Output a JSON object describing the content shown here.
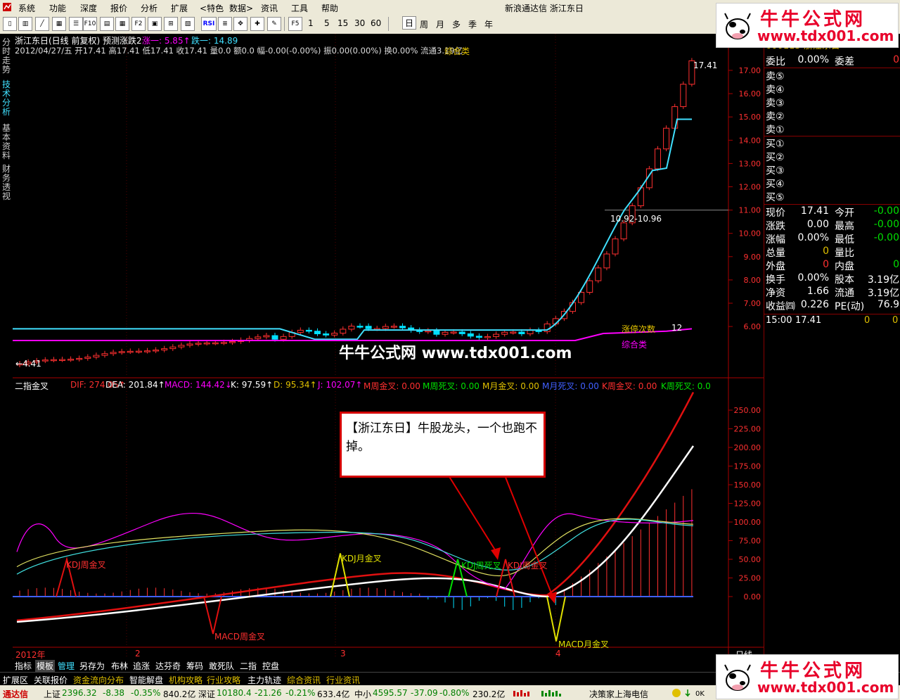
{
  "menubar": {
    "items": [
      "系统",
      "功能",
      "深度",
      "报价",
      "分析",
      "扩展",
      "特色",
      "数据",
      "资讯",
      "工具",
      "帮助"
    ],
    "title": "新浪通达信  浙江东日"
  },
  "toolbar": {
    "periods": [
      "1",
      "5",
      "15",
      "30",
      "60"
    ],
    "cycles": [
      "日",
      "周",
      "月",
      "多",
      "季",
      "年"
    ],
    "icons": [
      "rsi-icon"
    ]
  },
  "sidetabs": [
    "分时走势",
    "技术分析",
    "基本资料",
    "财务透视"
  ],
  "main_chart": {
    "title": "浙江东日(日线 前复权) 预测涨跌2",
    "up_label": "涨一: 5.85↑",
    "down_label": "跌一: 14.89",
    "info": "2012/04/27/五 开17.41 高17.41 低17.41 收17.41 量0.0 额0.0 幅-0.00(-0.00%) 振0.00(0.00%) 换0.00% 流通3.19亿",
    "info_tail": "综合类",
    "high_label": "17.41",
    "low_label": "4.41",
    "line_label": "10.92-10.96",
    "limit_up_label": "涨停次数",
    "limit_up_count": "12",
    "sector_label": "综合类",
    "y_ticks": [
      "17.00",
      "16.00",
      "15.00",
      "14.00",
      "13.00",
      "12.00",
      "11.00",
      "10.00",
      "9.00",
      "8.00",
      "7.00",
      "6.00"
    ]
  },
  "indicator": {
    "name": "二指金叉",
    "dif": "DIF: 274.05↑",
    "dea": "DEA: 201.84↑",
    "macd": "MACD: 144.42↓",
    "k": "K: 97.59↑",
    "d": "D: 95.34↑",
    "j": "J: 102.07↑",
    "m_week_gold": "M周金叉: 0.00",
    "m_week_dead": "M周死叉: 0.00",
    "m_month_gold": "M月金叉: 0.00",
    "m_month_dead": "M月死叉: 0.00",
    "k_week_gold": "K周金叉: 0.00",
    "k_week_dead": "K周死叉: 0.0",
    "y_ticks": [
      "250.00",
      "225.00",
      "200.00",
      "175.00",
      "150.00",
      "125.00",
      "100.00",
      "75.00",
      "50.00",
      "25.00",
      "0.00"
    ],
    "annotations": {
      "kdj_week_gold": "KDJ周金叉",
      "kdj_month_gold": "KDJ月金叉",
      "kdj_week_dead": "KDJ周死叉",
      "kdj_week_gold2": "KDJ周金叉",
      "macd_week_gold": "MACD周金叉",
      "macd_month_gold": "MACD月金叉"
    }
  },
  "x_axis": {
    "labels": [
      "2012年",
      "2",
      "3",
      "4"
    ],
    "right_label": "日线"
  },
  "callout": {
    "text": "【浙江东日】牛股龙头，一个也跑不掉。"
  },
  "watermark": {
    "brand": "牛牛公式网",
    "url": "www.tdx001.com",
    "mid": "牛牛公式网 www.tdx001.com"
  },
  "quote": {
    "header": "600113 浙江东日",
    "ratio_label": "委比",
    "ratio_value": "0.00%",
    "diff_label": "委差",
    "diff_value": "0",
    "asks": [
      "卖⑤",
      "卖④",
      "卖③",
      "卖②",
      "卖①"
    ],
    "bids": [
      "买①",
      "买②",
      "买③",
      "买④",
      "买⑤"
    ],
    "rows": [
      {
        "l1": "现价",
        "v1": "17.41",
        "l2": "今开",
        "v2": "-0.00",
        "c1": "#ffffff",
        "c2": "#00e000"
      },
      {
        "l1": "涨跌",
        "v1": "0.00",
        "l2": "最高",
        "v2": "-0.00",
        "c1": "#ffffff",
        "c2": "#00e000"
      },
      {
        "l1": "涨幅",
        "v1": "0.00%",
        "l2": "最低",
        "v2": "-0.00",
        "c1": "#ffffff",
        "c2": "#00e000"
      },
      {
        "l1": "总量",
        "v1": "0",
        "l2": "量比",
        "v2": "",
        "c1": "#e0c000",
        "c2": "#ffffff"
      },
      {
        "l1": "外盘",
        "v1": "0",
        "l2": "内盘",
        "v2": "0",
        "c1": "#ff3030",
        "c2": "#00e000"
      },
      {
        "l1": "换手",
        "v1": "0.00%",
        "l2": "股本",
        "v2": "3.19亿",
        "c1": "#ffffff",
        "c2": "#ffffff"
      },
      {
        "l1": "净资",
        "v1": "1.66",
        "l2": "流通",
        "v2": "3.19亿",
        "c1": "#ffffff",
        "c2": "#ffffff"
      },
      {
        "l1": "收益㈣",
        "v1": "0.226",
        "l2": "PE(动)",
        "v2": "76.9",
        "c1": "#ffffff",
        "c2": "#ffffff"
      }
    ],
    "tick": {
      "time": "15:00",
      "price": "17.41",
      "vol": "0",
      "flag": "0"
    }
  },
  "bottom_tabs": [
    "指标",
    "模板",
    "管理",
    "另存为",
    "布林",
    "追涨",
    "达芬奇",
    "筹码",
    "敢死队",
    "二指",
    "控盘"
  ],
  "ext_tabs": [
    {
      "t": "扩展区",
      "c": "#ffffff"
    },
    {
      "t": "关联报价",
      "c": "#ffffff"
    },
    {
      "t": "资金流向分布",
      "c": "#e0c000"
    },
    {
      "t": "智能解盘",
      "c": "#ffffff"
    },
    {
      "t": "机构攻略",
      "c": "#e0c000"
    },
    {
      "t": "行业攻略",
      "c": "#e0c000"
    },
    {
      "t": "主力轨迹",
      "c": "#ffffff"
    },
    {
      "t": "综合资讯",
      "c": "#e0c000"
    },
    {
      "t": "行业资讯",
      "c": "#e0c000"
    }
  ],
  "status": {
    "brand": "通达信",
    "sh_label": "上证",
    "sh_val": "2396.32",
    "sh_chg": "-8.38",
    "sh_pct": "-0.35%",
    "sh_amt": "840.2亿",
    "sz_label": "深证",
    "sz_val": "10180.4",
    "sz_chg": "-21.26",
    "sz_pct": "-0.21%",
    "sz_amt": "633.4亿",
    "zx_label": "中小",
    "zx_val": "4595.57",
    "zx_chg": "-37.09",
    "zx_pct": "-0.80%",
    "zx_amt": "230.2亿",
    "server": "决策家上海电信"
  },
  "colors": {
    "up": "#ff3030",
    "down": "#00e0ff",
    "ma": "#40e0ff",
    "sector": "#ff00ff",
    "bg": "#000000"
  }
}
